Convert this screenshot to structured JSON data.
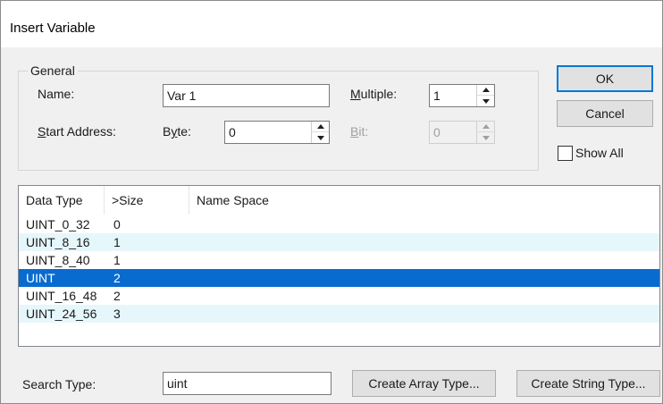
{
  "window": {
    "title": "Insert Variable"
  },
  "general": {
    "legend": "General",
    "name_label": "Name:",
    "name_value": "Var 1",
    "multiple_label_u": "M",
    "multiple_label_rest": "ultiple:",
    "multiple_value": "1",
    "start_address_label_u": "S",
    "start_address_label_rest": "tart Address:",
    "byte_label_pre": "B",
    "byte_label_u": "y",
    "byte_label_rest": "te:",
    "byte_value": "0",
    "bit_label_u": "B",
    "bit_label_rest": "it:",
    "bit_value": "0"
  },
  "buttons": {
    "ok": "OK",
    "cancel": "Cancel",
    "show_all": "Show All",
    "create_array": "Create Array Type...",
    "create_string": "Create String Type..."
  },
  "table": {
    "columns": [
      "Data Type",
      ">Size",
      "Name Space"
    ],
    "rows": [
      {
        "type": "UINT_0_32",
        "size": "0",
        "ns": ""
      },
      {
        "type": "UINT_8_16",
        "size": "1",
        "ns": ""
      },
      {
        "type": "UINT_8_40",
        "size": "1",
        "ns": ""
      },
      {
        "type": "UINT",
        "size": "2",
        "ns": ""
      },
      {
        "type": "UINT_16_48",
        "size": "2",
        "ns": ""
      },
      {
        "type": "UINT_24_56",
        "size": "3",
        "ns": ""
      }
    ],
    "selected_index": 3
  },
  "search": {
    "label": "Search Type:",
    "value": "uint"
  },
  "colors": {
    "selection": "#0a6bcf",
    "alt_row": "#e6f7fb",
    "default_button_border": "#0078d7"
  }
}
